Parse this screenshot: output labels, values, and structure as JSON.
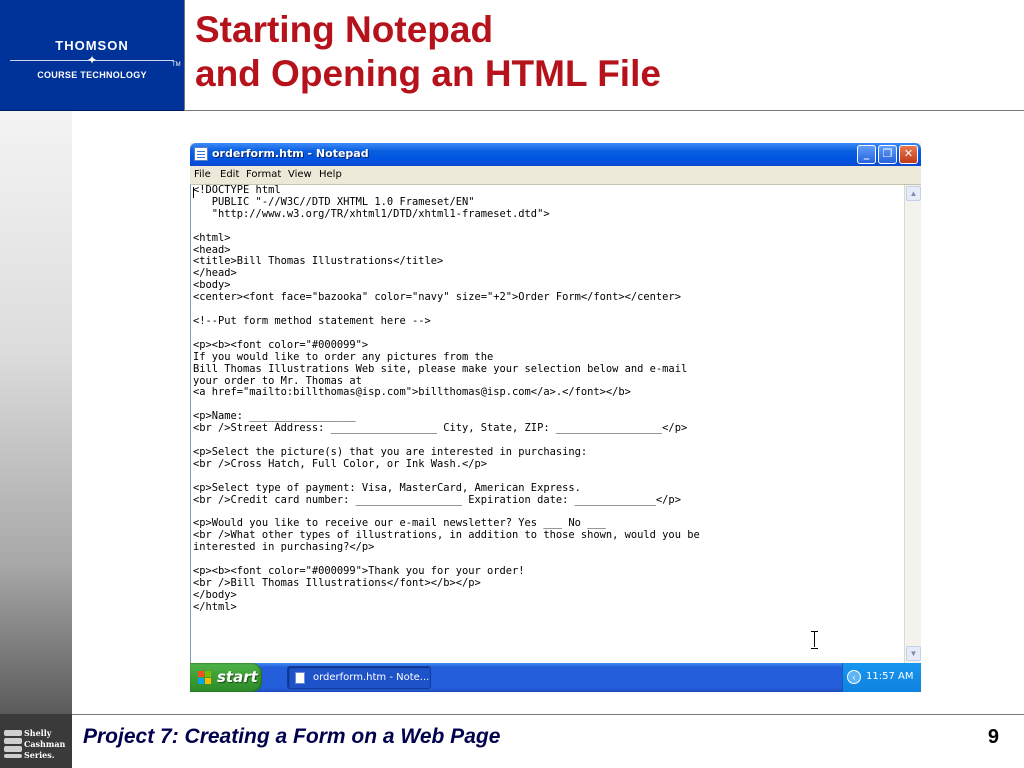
{
  "slide": {
    "logo": {
      "main": "THOMSON",
      "sub": "COURSE TECHNOLOGY",
      "tm": "TM"
    },
    "title_line1": "Starting Notepad",
    "title_line2": "and Opening an HTML File",
    "footer_title": "Project 7: Creating a Form on a Web Page",
    "page_number": "9",
    "series_logo": [
      "Shelly",
      "Cashman",
      "Series."
    ]
  },
  "notepad": {
    "title": "orderform.htm - Notepad",
    "menu": [
      "File",
      "Edit",
      "Format",
      "View",
      "Help"
    ],
    "content": "<!DOCTYPE html\n   PUBLIC \"-//W3C//DTD XHTML 1.0 Frameset/EN\"\n   \"http://www.w3.org/TR/xhtml1/DTD/xhtml1-frameset.dtd\">\n\n<html>\n<head>\n<title>Bill Thomas Illustrations</title>\n</head>\n<body>\n<center><font face=\"bazooka\" color=\"navy\" size=\"+2\">Order Form</font></center>\n\n<!--Put form method statement here -->\n\n<p><b><font color=\"#000099\">\nIf you would like to order any pictures from the\nBill Thomas Illustrations Web site, please make your selection below and e-mail\nyour order to Mr. Thomas at\n<a href=\"mailto:billthomas@isp.com\">billthomas@isp.com</a>.</font></b>\n\n<p>Name: _________________\n<br />Street Address: _________________ City, State, ZIP: _________________</p>\n\n<p>Select the picture(s) that you are interested in purchasing:\n<br />Cross Hatch, Full Color, or Ink Wash.</p>\n\n<p>Select type of payment: Visa, MasterCard, American Express.\n<br />Credit card number: _________________ Expiration date: _____________</p>\n\n<p>Would you like to receive our e-mail newsletter? Yes ___ No ___\n<br />What other types of illustrations, in addition to those shown, would you be\ninterested in purchasing?</p>\n\n<p><b><font color=\"#000099\">Thank you for your order!\n<br />Bill Thomas Illustrations</font></b></p>\n</body>\n</html>"
  },
  "taskbar": {
    "start_label": "start",
    "task_label": "orderform.htm - Note...",
    "clock": "11:57 AM"
  },
  "colors": {
    "title_red": "#b5121b",
    "logo_blue": "#003399",
    "xp_title_blue": "#0054e3",
    "start_green": "#3b9d33",
    "footer_navy": "#00004d"
  },
  "icons": {
    "window_buttons": [
      "minimize-icon",
      "maximize-icon",
      "close-icon"
    ],
    "scrollbar": [
      "scroll-up-icon",
      "scroll-down-icon"
    ],
    "tray": "show-hidden-icons-icon"
  }
}
